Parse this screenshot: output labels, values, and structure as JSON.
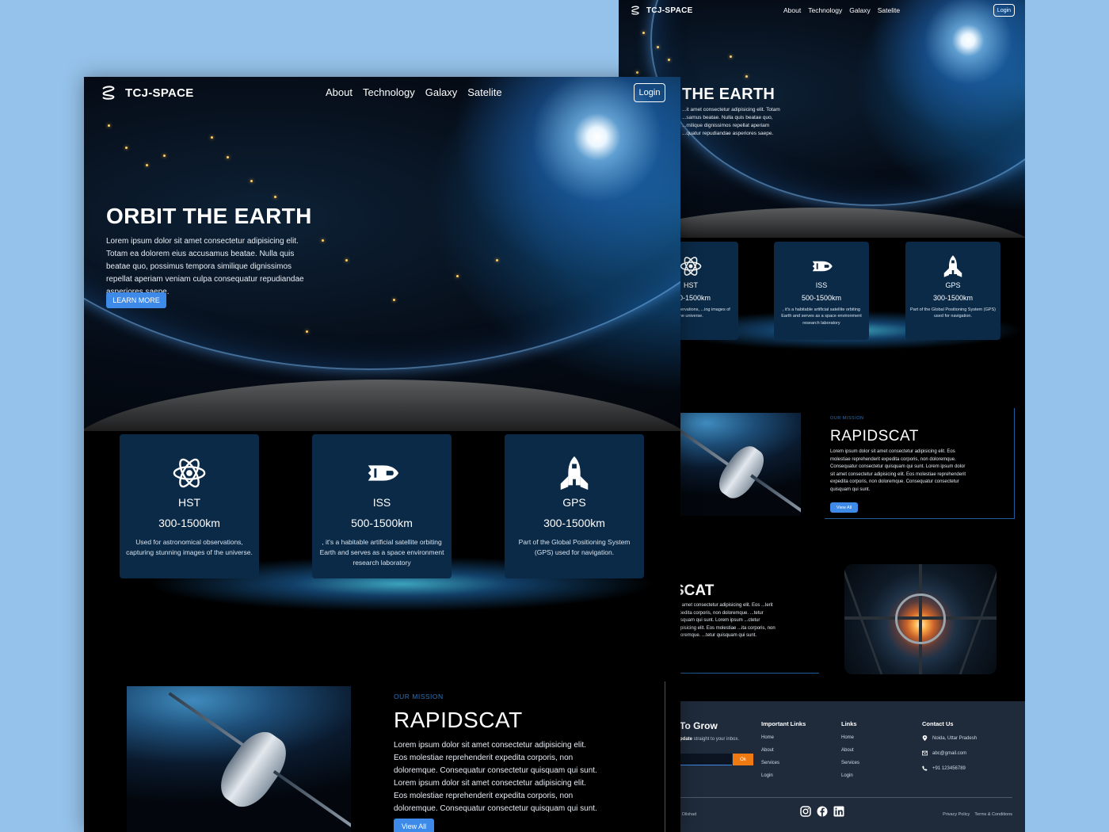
{
  "brand": {
    "name": "TCJ-SPACE",
    "logo_icon": "swirl-logo-icon"
  },
  "nav": {
    "links": [
      "About",
      "Technology",
      "Galaxy",
      "Satelite"
    ],
    "login": "Login"
  },
  "hero": {
    "title": "ORBIT THE EARTH",
    "title_cropped": "THE EARTH",
    "text": "Lorem ipsum dolor sit amet consectetur adipisicing elit. Totam ea dolorem eius accusamus beatae. Nulla quis beatae quo, possimus tempora similique dignissimos repellat aperiam veniam culpa consequatur repudiandae asperiores saepe.",
    "text_cropped": "...it amet consectetur adipisicing elit. Totam ...samus beatae. Nulla quis beatae quo, ...milique dignissimos repellat aperiam ...quatur repudiandae asperiores saepe.",
    "cta": "LEARN MORE"
  },
  "cards": [
    {
      "icon": "atom-icon",
      "name": "HST",
      "range": "300-1500km",
      "desc": "Used for astronomical observations, capturing stunning images of the universe.",
      "desc_cropped": "...onomical observations, ...ing images of the universe."
    },
    {
      "icon": "space-shuttle-icon",
      "name": "ISS",
      "range": "500-1500km",
      "desc": ", it's a habitable artificial satellite orbiting Earth and serves as a space environment research laboratory"
    },
    {
      "icon": "rocket-icon",
      "name": "GPS",
      "range": "300-1500km",
      "desc": "Part of the Global Positioning System (GPS) used for navigation."
    }
  ],
  "mission": {
    "kicker": "OUR MISSION",
    "title": "RAPIDSCAT",
    "text": "Lorem ipsum dolor sit amet consectetur adipisicing elit. Eos molestiae reprehenderit expedita corporis, non doloremque. Consequatur consectetur quisquam qui sunt. Lorem ipsum dolor sit amet consectetur adipisicing elit. Eos molestiae reprehenderit expedita corporis, non doloremque. Consequatur consectetur quisquam qui sunt.",
    "button": "View All",
    "button_small": "View All"
  },
  "mission2": {
    "title": "SCAT",
    "text": "...it amet consectetur adipisicing elit. Eos ...lerit expedita corporis, non doloremque. ...tetur quisquam qui sunt. Lorem ipsum ...ctetur adipisicing elit. Eos molestiae ...ita corporis, non doloremque. ...tetur quisquam qui sunt."
  },
  "footer": {
    "grow_title": "To Grow",
    "sub_bold": "pdate",
    "sub_rest": " straight to your inbox.",
    "ok": "Ok",
    "important_links": {
      "title": "Important Links",
      "items": [
        "Home",
        "About",
        "Services",
        "Login"
      ]
    },
    "links": {
      "title": "Links",
      "items": [
        "Home",
        "About",
        "Services",
        "Login"
      ]
    },
    "contact": {
      "title": "Contact Us",
      "items": [
        {
          "icon": "location-pin-icon",
          "text": "Noida, Uttar Pradesh"
        },
        {
          "icon": "mail-icon",
          "text": "abc@gmail.com"
        },
        {
          "icon": "phone-icon",
          "text": "+91 123456789"
        }
      ]
    },
    "copyright": "| Dilshad",
    "social": [
      "instagram-icon",
      "facebook-icon",
      "linkedin-icon"
    ],
    "legal": [
      "Privacy Policy",
      "Terms & Conditions"
    ]
  },
  "colors": {
    "page_bg": "#95c2ea",
    "card_bg": "#0b2a47",
    "accent": "#3d8ae8",
    "ok_button": "#f07a12",
    "footer_bg": "#1f2b3b"
  }
}
